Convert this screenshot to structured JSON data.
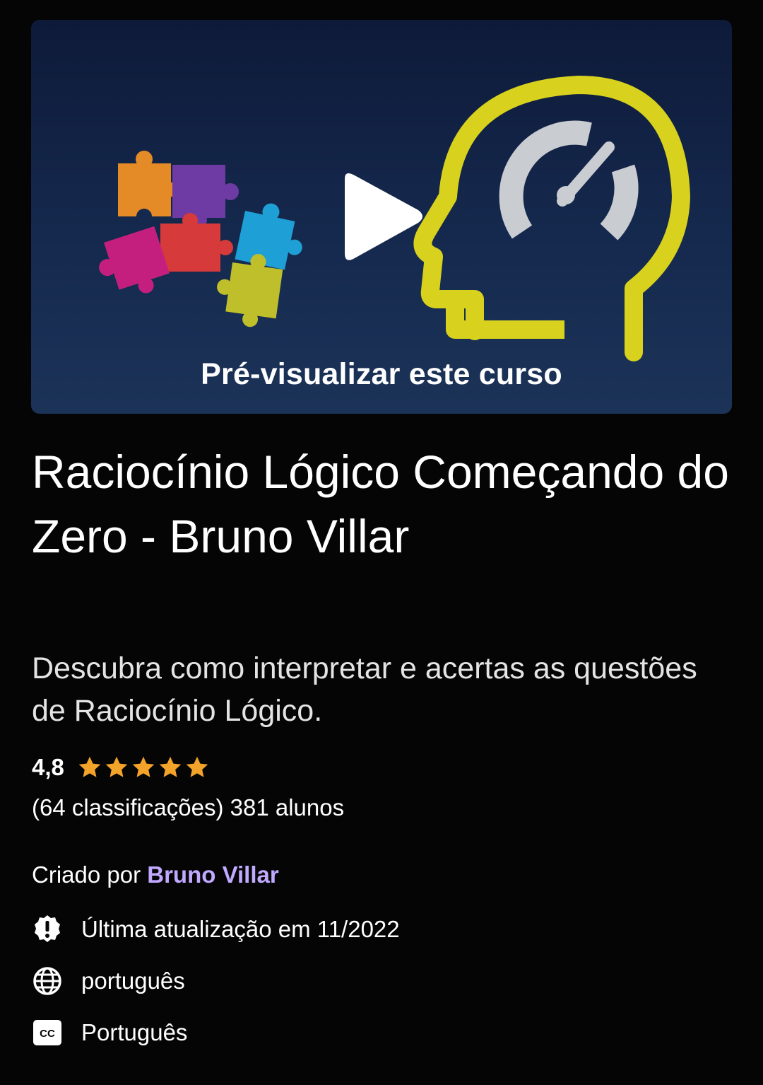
{
  "preview": {
    "label": "Pré-visualizar este curso",
    "art": [
      "puzzle-pieces",
      "play-icon",
      "head-speedometer"
    ]
  },
  "course": {
    "title": "Raciocínio Lógico Começando do Zero - Bruno Villar",
    "subtitle": "Descubra como interpretar e acertas as questões de Raciocínio Lógico.",
    "rating": "4,8",
    "stars": 5,
    "ratings_count": "(64 classificações)",
    "students": "381 alunos",
    "created_by_label": "Criado por",
    "creator": "Bruno Villar",
    "last_updated": "Última atualização em 11/2022",
    "language": "português",
    "captions": "Português"
  },
  "icons": {
    "updated": "alert-badge-icon",
    "language": "globe-icon",
    "captions": "closed-captions-icon"
  },
  "colors": {
    "background": "#050505",
    "star": "#f4a32a",
    "creator_link": "#c0a9ff",
    "preview_bg": "#15294e"
  }
}
